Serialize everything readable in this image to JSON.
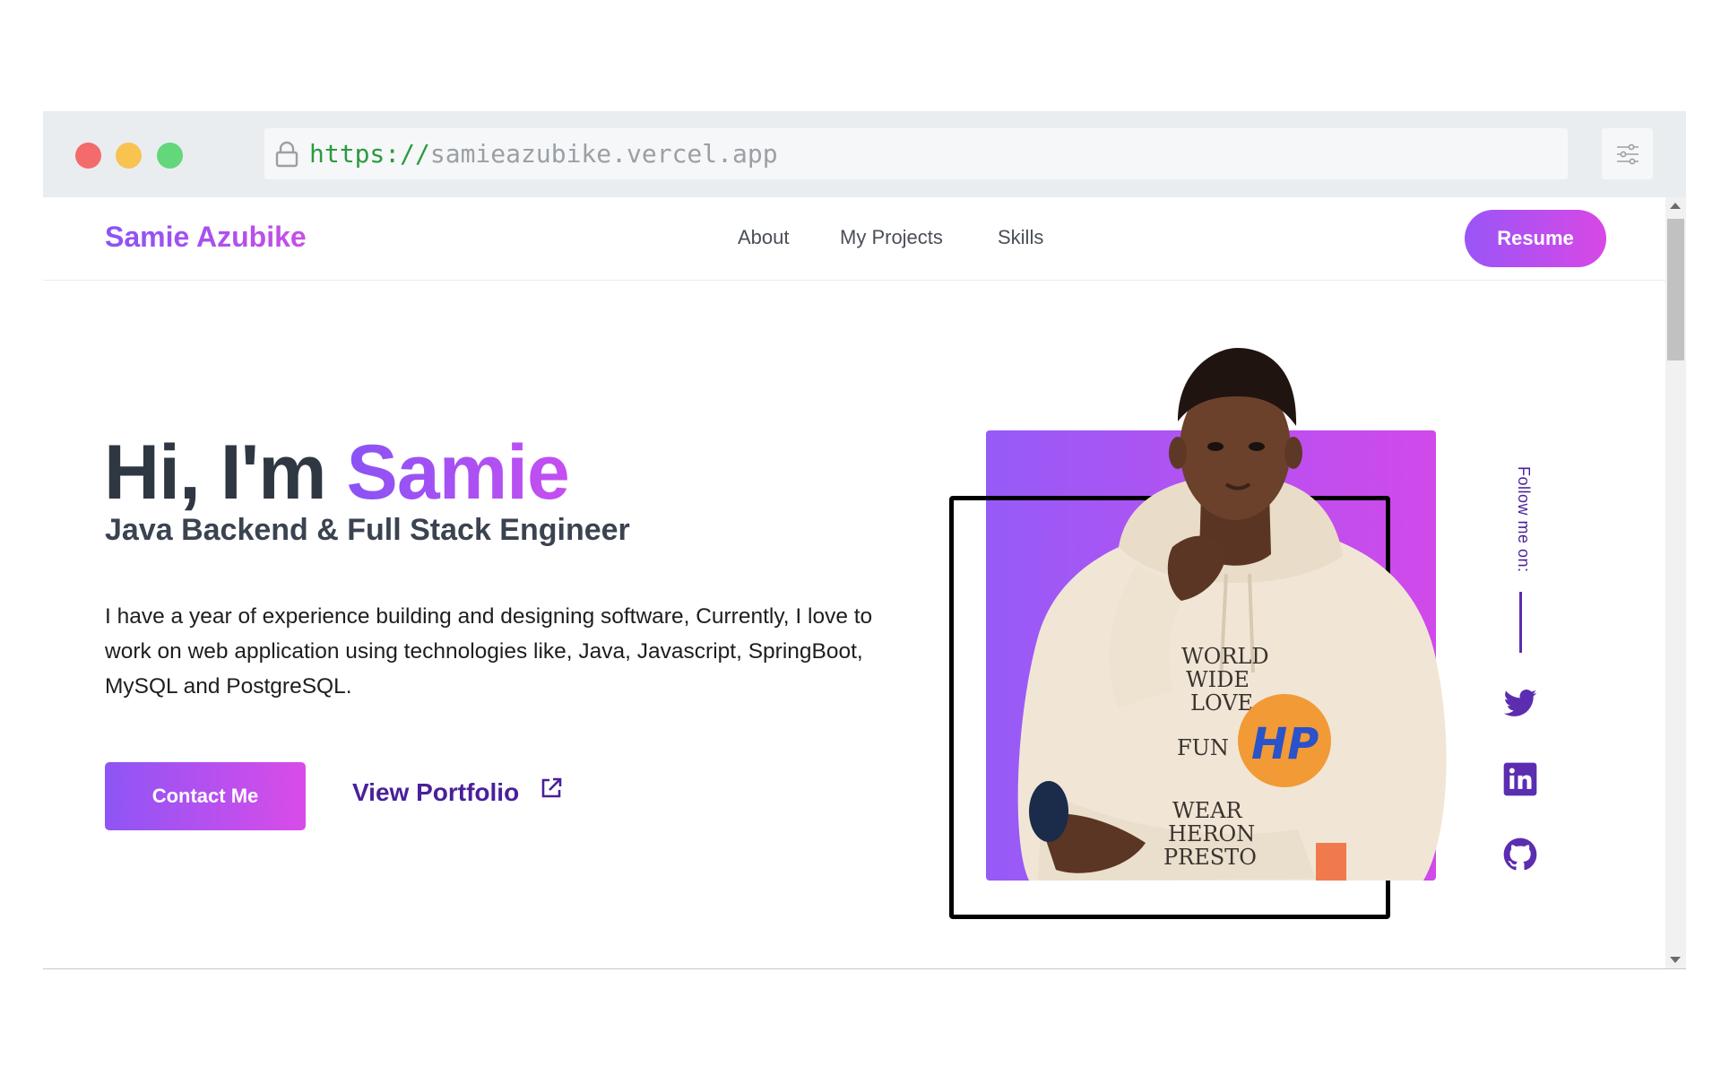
{
  "browser": {
    "url_scheme": "https://",
    "url_host": "samieazubike.vercel.app"
  },
  "nav": {
    "brand": "Samie Azubike",
    "links": [
      "About",
      "My Projects",
      "Skills"
    ],
    "resume": "Resume"
  },
  "hero": {
    "greeting": "Hi, I'm ",
    "name": "Samie",
    "role": "Java Backend & Full Stack Engineer",
    "description": "I have a year of experience building and designing software, Currently, I love to work on web application using technologies like, Java, Javascript, SpringBoot, MySQL and PostgreSQL.",
    "contact_button": "Contact Me",
    "portfolio_link": "View Portfolio"
  },
  "portrait": {
    "hoodie_text": [
      "WORLD",
      "WIDE",
      "LOVE",
      "FUN",
      "WEAR",
      "HERON",
      "PRESTO"
    ],
    "badge": "HP"
  },
  "social": {
    "label": "Follow me on:",
    "icons": [
      "twitter-icon",
      "linkedin-icon",
      "github-icon"
    ]
  },
  "colors": {
    "accent_start": "#8a53f5",
    "accent_end": "#d848e6",
    "link_purple": "#4a1f9a",
    "heading": "#2f3742"
  }
}
